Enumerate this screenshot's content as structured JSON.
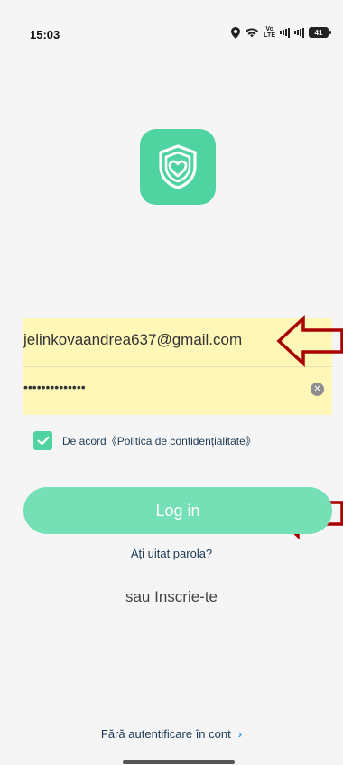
{
  "status_bar": {
    "time": "15:03",
    "volte_top": "Vo",
    "volte_bottom": "LTE",
    "battery": "41",
    "icons": [
      "location-icon",
      "wifi-icon",
      "signal-icon",
      "battery-icon"
    ]
  },
  "app": {
    "brand_color": "#4fd3a0",
    "logo_icon": "shield-heart-icon"
  },
  "form": {
    "email_value": "jelinkovaandrea637@gmail.com",
    "password_value": "••••••••••••••",
    "highlight_color": "#fef7b8",
    "arrow_color": "#a80000"
  },
  "agree": {
    "label": "De acord《Politica de confidențialitate》"
  },
  "actions": {
    "login_label": "Log in",
    "forgot_label": "Ați uitat parola?",
    "signup_label": "sau Inscrie-te",
    "no_auth_label": "Fără autentificare în cont",
    "no_auth_chevron": "›"
  }
}
